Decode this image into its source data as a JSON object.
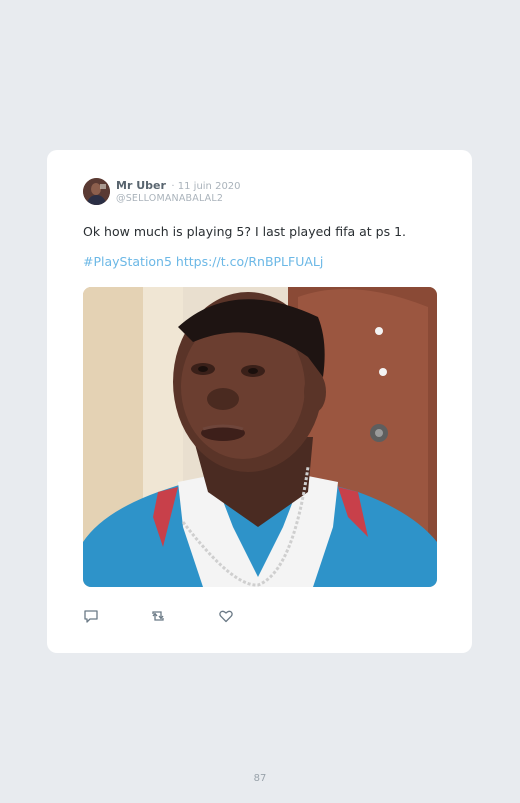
{
  "tweet": {
    "author_name": "Mr Uber",
    "date": "· 11 juin 2020",
    "handle": "@SELLOMANABALAL2",
    "text": "Ok how much is playing 5? I last played fifa at ps 1.",
    "hashtag": "#PlayStation5",
    "link": "https://t.co/RnBPLFUALj",
    "media_icon": "photo-of-man-in-blue-polo-shirt",
    "actions": {
      "reply_icon": "reply-icon",
      "retweet_icon": "retweet-icon",
      "like_icon": "heart-icon"
    }
  },
  "page_number": "87",
  "colors": {
    "background": "#e8ebef",
    "card": "#ffffff",
    "link": "#6cb8e6",
    "name": "#59656f",
    "muted": "#aab3bb",
    "icon": "#6b7a86"
  }
}
